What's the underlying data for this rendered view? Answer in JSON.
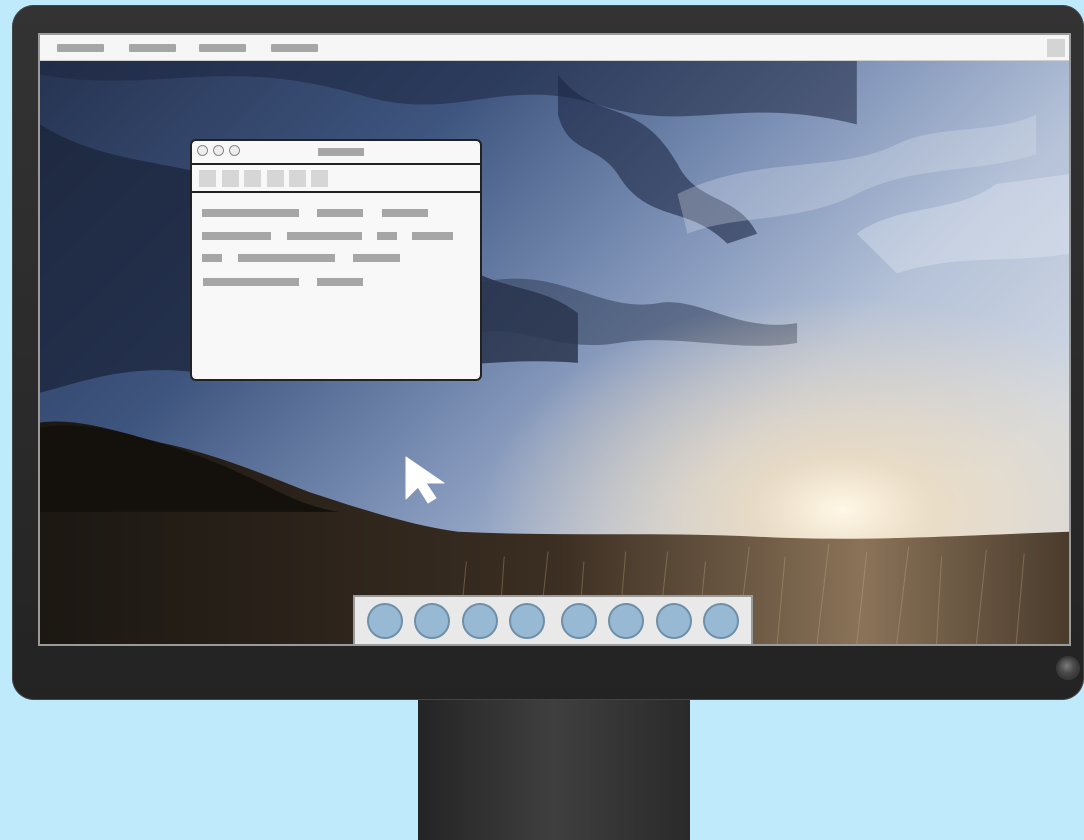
{
  "screen": {
    "menubar": {
      "items": [
        "",
        "",
        "",
        ""
      ]
    },
    "window": {
      "title": "",
      "traffic_lights": [
        "close-button",
        "minimize-button",
        "zoom-button"
      ],
      "toolbar_button_count": 6
    },
    "dock": {
      "items": [
        "app-1",
        "app-2",
        "app-3",
        "app-4",
        "app-5",
        "app-6",
        "app-7",
        "app-8"
      ]
    },
    "cursor": {
      "icon": "arrow-pointer"
    }
  },
  "colors": {
    "page_background": "#bfeafb",
    "monitor_bezel": "#2e2e2e",
    "menubar": "#f6f6f6",
    "placeholder_text": "#a6a6a6",
    "dock_icon": "#98b9d3"
  }
}
